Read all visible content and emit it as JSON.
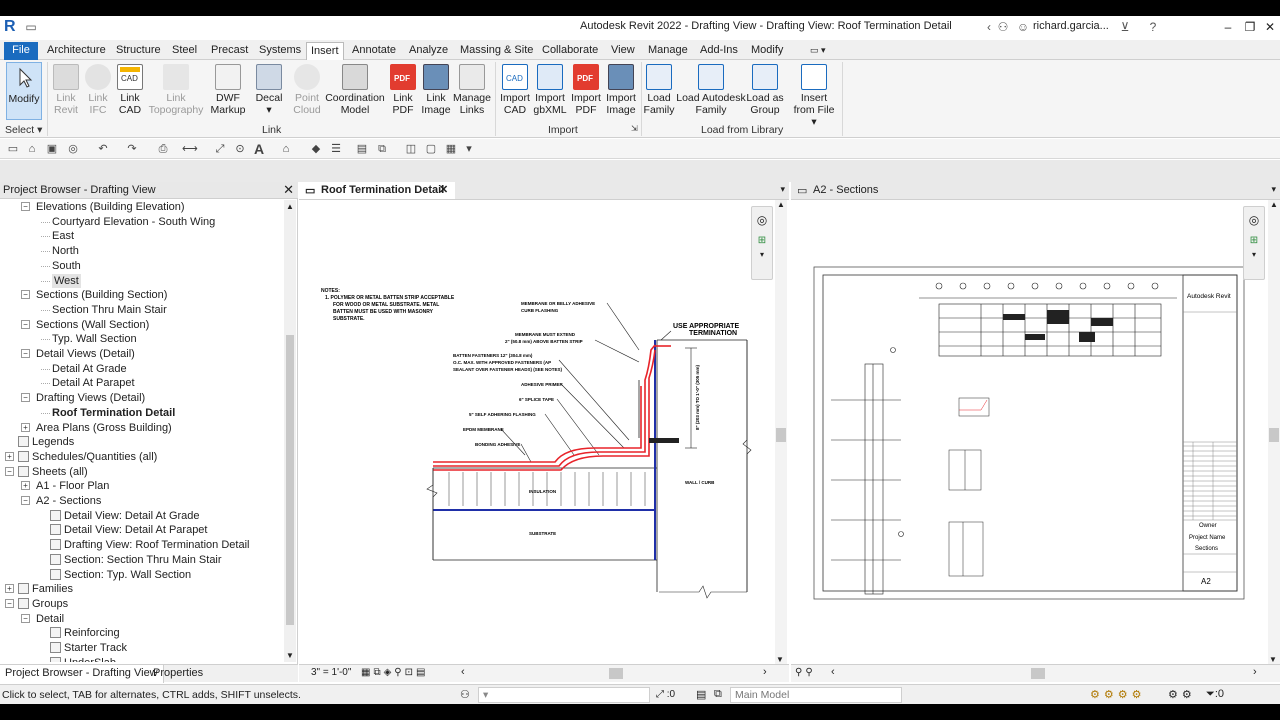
{
  "window": {
    "title": "Autodesk Revit 2022 - Drafting View - Drafting View: Roof Termination Detail",
    "user": "richard.garcia...",
    "minimize": "‒",
    "restore": "❐",
    "close": "✕"
  },
  "ribbon_tabs": [
    "Architecture",
    "Structure",
    "Steel",
    "Precast",
    "Systems",
    "Insert",
    "Annotate",
    "Analyze",
    "Massing & Site",
    "Collaborate",
    "View",
    "Manage",
    "Add-Ins",
    "Modify"
  ],
  "file_tab": "File",
  "active_tab": "Insert",
  "ribbon": {
    "modify": "Modify",
    "select": "Select",
    "link_group": [
      "Link Revit",
      "Link IFC",
      "Link CAD",
      "Link Topography",
      "DWF Markup",
      "Decal",
      "Point Cloud",
      "Coordination Model",
      "Link PDF",
      "Link Image",
      "Manage Links"
    ],
    "link_label": "Link",
    "import_group": [
      "Import CAD",
      "Import gbXML",
      "Import PDF",
      "Import Image"
    ],
    "import_label": "Import",
    "library_group": [
      "Load Family",
      "Load Autodesk Family",
      "Load as Group",
      "Insert from File"
    ],
    "library_label": "Load from Library"
  },
  "project_browser": {
    "title": "Project Browser - Drafting View",
    "items": [
      {
        "label": "Elevations (Building Elevation)",
        "level": 1,
        "exp": "-"
      },
      {
        "label": "Courtyard Elevation - South Wing",
        "level": 2
      },
      {
        "label": "East",
        "level": 2
      },
      {
        "label": "North",
        "level": 2
      },
      {
        "label": "South",
        "level": 2
      },
      {
        "label": "West",
        "level": 2,
        "selected": true
      },
      {
        "label": "Sections (Building Section)",
        "level": 1,
        "exp": "-"
      },
      {
        "label": "Section Thru Main Stair",
        "level": 2
      },
      {
        "label": "Sections (Wall Section)",
        "level": 1,
        "exp": "-"
      },
      {
        "label": "Typ. Wall Section",
        "level": 2
      },
      {
        "label": "Detail Views (Detail)",
        "level": 1,
        "exp": "-"
      },
      {
        "label": "Detail At Grade",
        "level": 2
      },
      {
        "label": "Detail At Parapet",
        "level": 2
      },
      {
        "label": "Drafting Views (Detail)",
        "level": 1,
        "exp": "-"
      },
      {
        "label": "Roof Termination Detail",
        "level": 2,
        "bold": true
      },
      {
        "label": "Area Plans (Gross Building)",
        "level": 1,
        "exp": "+"
      },
      {
        "label": "Legends",
        "level": 0,
        "icon": true
      },
      {
        "label": "Schedules/Quantities (all)",
        "level": 0,
        "exp": "+",
        "icon": true
      },
      {
        "label": "Sheets (all)",
        "level": 0,
        "exp": "-",
        "icon": true
      },
      {
        "label": "A1 - Floor Plan",
        "level": 1,
        "exp": "+"
      },
      {
        "label": "A2 - Sections",
        "level": 1,
        "exp": "-"
      },
      {
        "label": "Detail View: Detail At Grade",
        "level": 2,
        "icon": true
      },
      {
        "label": "Detail View: Detail At Parapet",
        "level": 2,
        "icon": true
      },
      {
        "label": "Drafting View: Roof Termination Detail",
        "level": 2,
        "icon": true
      },
      {
        "label": "Section: Section Thru Main Stair",
        "level": 2,
        "icon": true
      },
      {
        "label": "Section: Typ. Wall Section",
        "level": 2,
        "icon": true
      },
      {
        "label": "Families",
        "level": 0,
        "exp": "+",
        "icon": true
      },
      {
        "label": "Groups",
        "level": 0,
        "exp": "-",
        "icon": true
      },
      {
        "label": "Detail",
        "level": 1,
        "exp": "-"
      },
      {
        "label": "Reinforcing",
        "level": 2,
        "icon": true
      },
      {
        "label": "Starter Track",
        "level": 2,
        "icon": true
      },
      {
        "label": "UnderSlab",
        "level": 2,
        "icon": true
      }
    ]
  },
  "bottom_tabs": [
    "Project Browser - Drafting View",
    "Properties"
  ],
  "view_tabs": {
    "left": "Roof Termination Detail",
    "right": "A2 - Sections"
  },
  "view_scale": "3\" = 1'-0\"",
  "detail_notes": {
    "notes": "NOTES:",
    "note1": "1. POLYMER OR METAL BATTEN STRIP ACCEPTABLE",
    "note1b": "FOR WOOD OR METAL SUBSTRATE. METAL",
    "note1c": "BATTEN MUST BE USED WITH MASONRY",
    "note1d": "SUBSTRATE.",
    "membrane_adhesive": "MEMBRANE OR BELLY ADHESIVE",
    "curb_flashing": "CURB FLASHING",
    "membrane_must_extend": "MEMBRANE MUST EXTEND",
    "above_batten": "2\" (50.8 mm) ABOVE BATTEN STRIP",
    "use_appropriate": "USE APPROPRIATE",
    "termination": "TERMINATION",
    "batten_fasteners": "BATTEN FASTENERS 12\" (304.8 mm)",
    "oc_max": "O.C. MAX. WITH APPROVED FASTENERS (AP",
    "sealant": "SEALANT OVER FASTENER HEADS) (SEE NOTES)",
    "adhesive_primer": "ADHESIVE PRIMER",
    "splice_tape": "6\" SPLICE TAPE",
    "self_adhering": "5\" SELF ADHERING FLASHING",
    "epdm": "EPDM MEMBRANE",
    "bonding": "BONDING ADHESIVE",
    "dim": "8\" (203 mm) TO 1'-0\" (305 mm)",
    "insulation": "INSULATION",
    "substrate": "SUBSTRATE",
    "wall_curb": "WALL / CURB"
  },
  "sheet": {
    "brand": "Autodesk Revit",
    "owner": "Owner",
    "project": "Project Name",
    "sheet_name": "Sections",
    "number": "A2"
  },
  "status": {
    "message": "Click to select, TAB for alternates, CTRL adds, SHIFT unselects.",
    "workset_value": "0",
    "model": "Main Model",
    "filter_count": ":0"
  },
  "colors": {
    "accent": "#1a6bbf",
    "flashing": "#e8242a",
    "substrate": "#1f2fa8"
  }
}
